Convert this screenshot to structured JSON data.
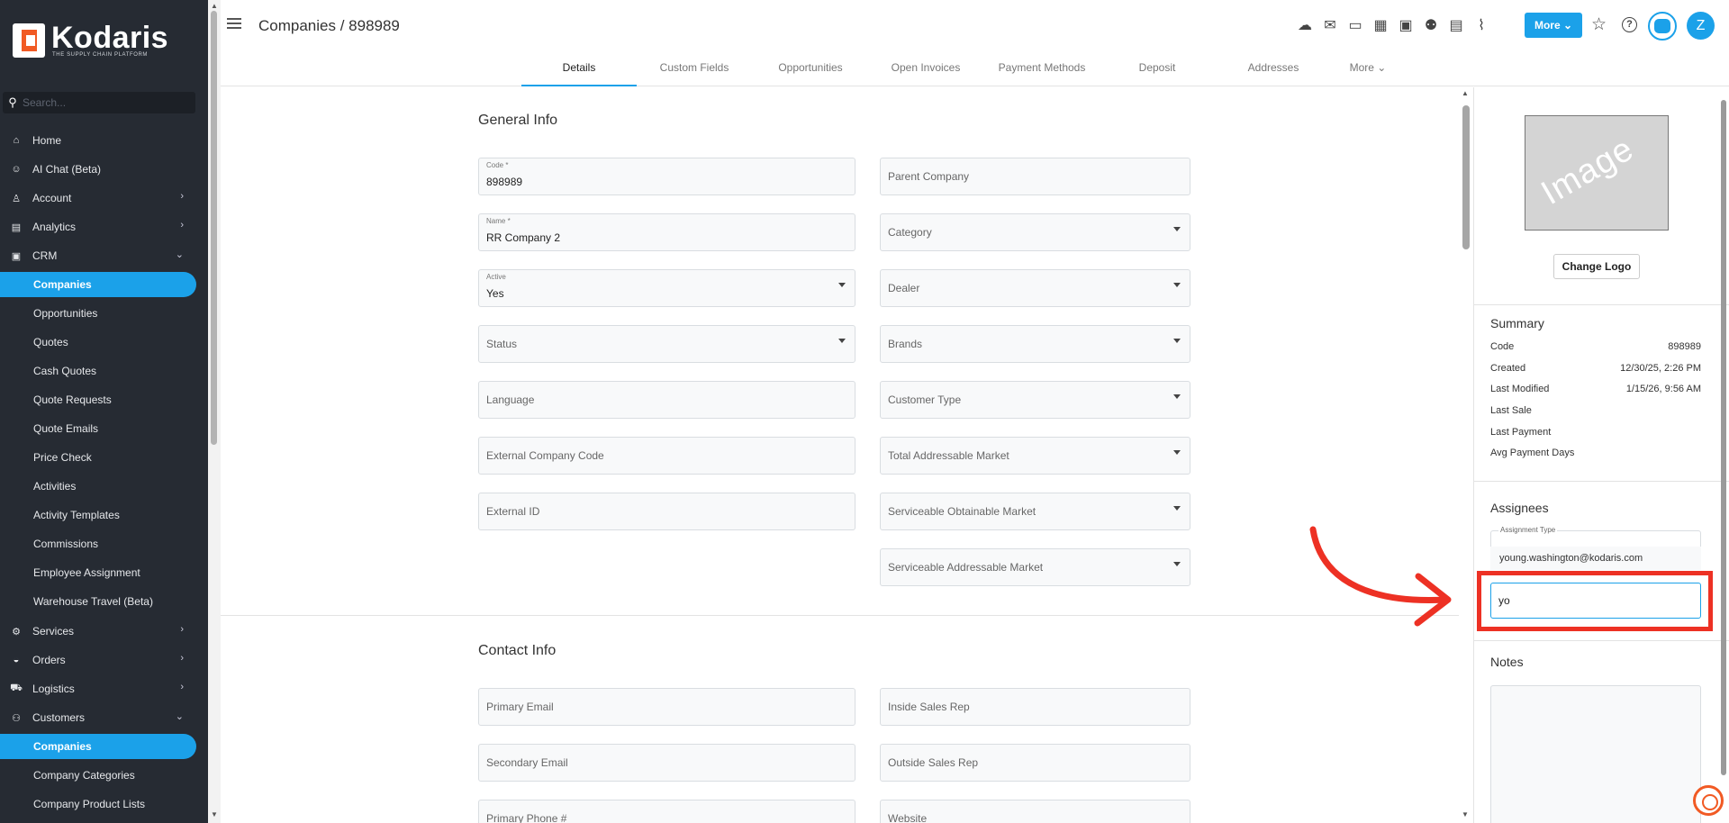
{
  "brand": {
    "name": "Kodaris",
    "tagline": "THE SUPPLY CHAIN PLATFORM",
    "accent": "#1ba1e9",
    "logo_color": "#f15a24"
  },
  "sidebar": {
    "search_placeholder": "Search...",
    "items": [
      {
        "label": "Home",
        "icon": "home-icon",
        "chevron": ""
      },
      {
        "label": "AI Chat (Beta)",
        "icon": "robot-icon",
        "chevron": ""
      },
      {
        "label": "Account",
        "icon": "user-icon",
        "chevron": "›"
      },
      {
        "label": "Analytics",
        "icon": "chart-icon",
        "chevron": "›"
      },
      {
        "label": "CRM",
        "icon": "crm-icon",
        "chevron": "⌄"
      },
      {
        "label": "Companies",
        "active": true
      },
      {
        "label": "Opportunities"
      },
      {
        "label": "Quotes"
      },
      {
        "label": "Cash Quotes"
      },
      {
        "label": "Quote Requests"
      },
      {
        "label": "Quote Emails"
      },
      {
        "label": "Price Check"
      },
      {
        "label": "Activities"
      },
      {
        "label": "Activity Templates"
      },
      {
        "label": "Commissions"
      },
      {
        "label": "Employee Assignment"
      },
      {
        "label": "Warehouse Travel (Beta)"
      },
      {
        "label": "Services",
        "icon": "services-icon",
        "chevron": "›"
      },
      {
        "label": "Orders",
        "icon": "car-icon",
        "chevron": "›"
      },
      {
        "label": "Logistics",
        "icon": "truck-icon",
        "chevron": "›"
      },
      {
        "label": "Customers",
        "icon": "people-icon",
        "chevron": "⌄"
      },
      {
        "label": "Companies",
        "active": true
      },
      {
        "label": "Company Categories"
      },
      {
        "label": "Company Product Lists"
      }
    ]
  },
  "header": {
    "title": "Companies / 898989",
    "more_label": "More ⌄",
    "avatar_letter": "Z"
  },
  "tabs": [
    {
      "label": "Details",
      "active": true
    },
    {
      "label": "Custom Fields"
    },
    {
      "label": "Opportunities"
    },
    {
      "label": "Open Invoices"
    },
    {
      "label": "Payment Methods"
    },
    {
      "label": "Deposit"
    },
    {
      "label": "Addresses"
    },
    {
      "label": "More ⌄"
    }
  ],
  "general_info": {
    "title": "General Info",
    "code": {
      "label": "Code *",
      "value": "898989"
    },
    "name": {
      "label": "Name *",
      "value": "RR Company 2"
    },
    "active": {
      "label": "Active",
      "value": "Yes"
    },
    "status": "Status",
    "language": "Language",
    "external_company_code": "External Company Code",
    "external_id": "External ID",
    "parent_company": "Parent Company",
    "category": "Category",
    "dealer": "Dealer",
    "brands": "Brands",
    "customer_type": "Customer Type",
    "total_addressable_market": "Total Addressable Market",
    "serviceable_obtainable_market": "Serviceable Obtainable Market",
    "serviceable_addressable_market": "Serviceable Addressable Market"
  },
  "contact_info": {
    "title": "Contact Info",
    "primary_email": "Primary Email",
    "secondary_email": "Secondary Email",
    "primary_phone": "Primary Phone #",
    "inside_sales_rep": "Inside Sales Rep",
    "outside_sales_rep": "Outside Sales Rep",
    "website": "Website"
  },
  "right_panel": {
    "image_text": "Image",
    "change_logo": "Change Logo",
    "summary": {
      "title": "Summary",
      "rows": [
        {
          "k": "Code",
          "v": "898989"
        },
        {
          "k": "Created",
          "v": "12/30/25, 2:26 PM"
        },
        {
          "k": "Last Modified",
          "v": "1/15/26, 9:56 AM"
        },
        {
          "k": "Last Sale",
          "v": ""
        },
        {
          "k": "Last Payment",
          "v": ""
        },
        {
          "k": "Avg Payment Days",
          "v": ""
        }
      ]
    },
    "assignees": {
      "title": "Assignees",
      "assignment_type_label": "Assignment Type",
      "suggestion": "young.washington@kodaris.com",
      "input_value": "yo"
    },
    "notes_title": "Notes"
  }
}
